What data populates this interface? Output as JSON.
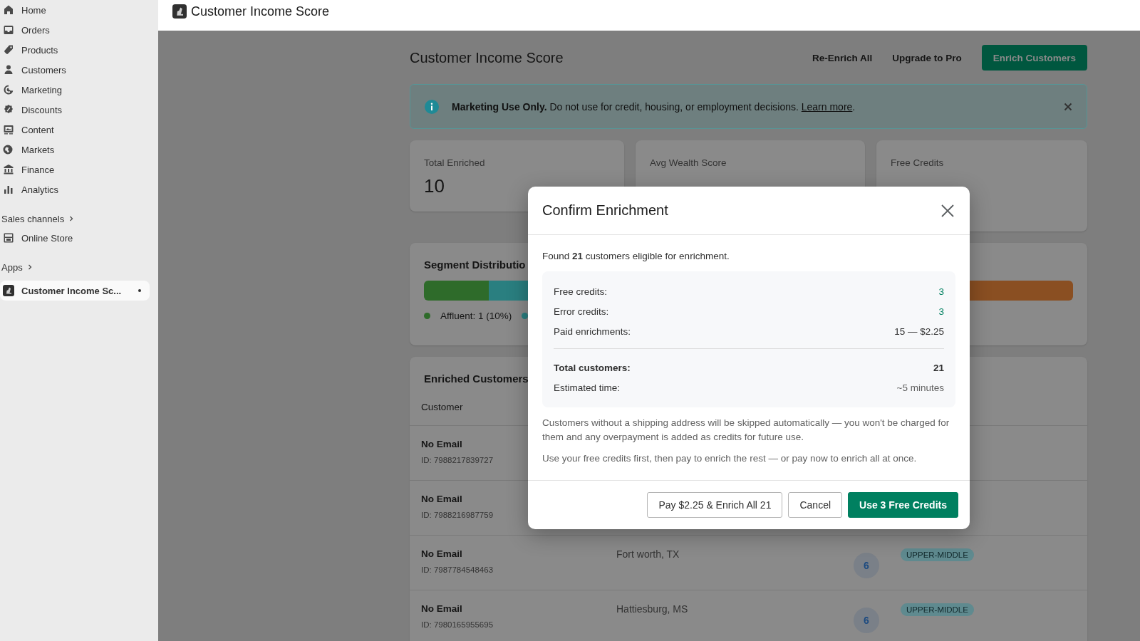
{
  "sidebar": {
    "nav": [
      {
        "label": "Home",
        "selected": false
      },
      {
        "label": "Orders",
        "selected": false
      },
      {
        "label": "Products",
        "selected": false
      },
      {
        "label": "Customers",
        "selected": false
      },
      {
        "label": "Marketing",
        "selected": false
      },
      {
        "label": "Discounts",
        "selected": false
      },
      {
        "label": "Content",
        "selected": false
      },
      {
        "label": "Markets",
        "selected": false
      },
      {
        "label": "Finance",
        "selected": false
      },
      {
        "label": "Analytics",
        "selected": false
      }
    ],
    "sales_channels": {
      "heading": "Sales channels",
      "items": [
        {
          "label": "Online Store",
          "selected": false
        }
      ]
    },
    "apps": {
      "heading": "Apps",
      "items": [
        {
          "label": "Customer Income Sc...",
          "selected": true
        }
      ]
    }
  },
  "top_bar": {
    "title": "Customer Income Score"
  },
  "header": {
    "title": "Customer Income Score",
    "actions": [
      {
        "label": "Re-Enrich All",
        "kind": "plain"
      },
      {
        "label": "Upgrade to Pro",
        "kind": "plain"
      },
      {
        "label": "Enrich Customers",
        "kind": "primary"
      }
    ]
  },
  "banner": {
    "text": "**Marketing Use Only.** Do not use for credit, housing, or employment decisions. ",
    "link": "Learn more",
    "end": "."
  },
  "stats": [
    {
      "label": "Total Enriched",
      "value": "10"
    },
    {
      "label": "Avg Wealth Score"
    },
    {
      "label": "Free Credits"
    }
  ],
  "segments": {
    "title": "Segment Distributio",
    "legend": [
      {
        "label": "Affluent: 1 (10%)",
        "color": "#2e6b2a"
      },
      {
        "color": "#2a7f80"
      }
    ]
  },
  "customers": {
    "title": "Enriched Customers",
    "columns": [
      "Customer"
    ],
    "rows": [
      {
        "name": "No Email",
        "id": "ID: 7988217839727"
      },
      {
        "name": "No Email",
        "id": "ID: 7988216987759"
      },
      {
        "name": "No Email",
        "id": "ID: 7987784548463",
        "location": "Fort worth, TX",
        "score": "6",
        "segment": "UPPER-MIDDLE"
      },
      {
        "name": "No Email",
        "id": "ID: 7980165955695",
        "location": "Hattiesburg, MS",
        "score": "6",
        "segment": "UPPER-MIDDLE"
      }
    ]
  },
  "modal": {
    "title": "Confirm Enrichment",
    "intro": "Found **21** customers eligible for enrichment.",
    "summary": [
      {
        "label": "Free credits:",
        "value": "3",
        "kind": "credit"
      },
      {
        "label": "Error credits:",
        "value": "3",
        "kind": "credit"
      },
      {
        "label": "Paid enrichments:",
        "value": "15 — $2.25",
        "kind": "plain"
      }
    ],
    "totals": [
      {
        "label": "Total customers:",
        "value": "21",
        "kind": "total"
      },
      {
        "label": "Estimated time:",
        "value": "~5 minutes",
        "kind": "muted"
      }
    ],
    "notes": [
      "Customers without a shipping address will be skipped automatically — you won't be charged for them and any overpayment is added as credits for future use.",
      "Use your free credits first, then pay to enrich the rest — or pay now to enrich all at once."
    ],
    "buttons": [
      {
        "label": "Pay $2.25 & Enrich All 21",
        "kind": "secondary"
      },
      {
        "label": "Cancel",
        "kind": "secondary"
      },
      {
        "label": "Use 3 Free Credits",
        "kind": "primary"
      }
    ]
  }
}
